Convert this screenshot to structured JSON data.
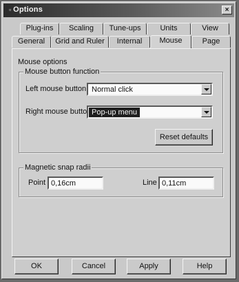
{
  "window": {
    "title": "Options",
    "close_glyph": "×"
  },
  "tabs_row1": [
    "Plug-ins",
    "Scaling",
    "Tune-ups",
    "Units",
    "View"
  ],
  "tabs_row2": [
    "General",
    "Grid and Ruler",
    "Internal",
    "Mouse",
    "Page"
  ],
  "active_tab": "Mouse",
  "mouse_options": {
    "heading": "Mouse options",
    "button_group_title": "Mouse button function",
    "left_label": "Left mouse button",
    "left_value": "Normal click",
    "right_label": "Right mouse button",
    "right_value": "Pop-up menu",
    "reset_label": "Reset defaults"
  },
  "snap": {
    "group_title": "Magnetic snap radii",
    "point_label": "Point",
    "point_value": "0,16cm",
    "line_label": "Line",
    "line_value": "0,11cm"
  },
  "buttons": {
    "ok": "OK",
    "cancel": "Cancel",
    "apply": "Apply",
    "help": "Help"
  },
  "icons": {
    "title_icon": "options-icon",
    "close": "close-icon",
    "dropdown": "chevron-down-icon"
  }
}
